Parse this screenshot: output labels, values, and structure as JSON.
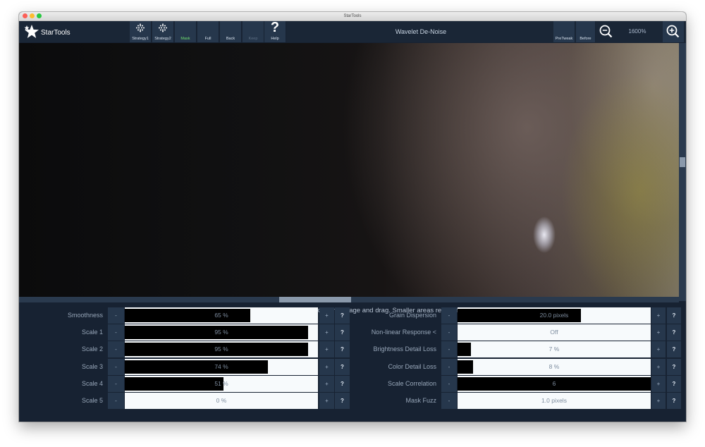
{
  "window": {
    "title": "StarTools"
  },
  "app": {
    "logo_text": "StarTools"
  },
  "toolbar": {
    "buttons": [
      {
        "label": "Strategy1"
      },
      {
        "label": "Strategy2"
      },
      {
        "label": "Mask"
      },
      {
        "label": "Full"
      },
      {
        "label": "Back"
      },
      {
        "label": "Keep"
      },
      {
        "label": "Help",
        "icon": "?"
      }
    ],
    "tool_title": "Wavelet De-Noise",
    "pretweak_label": "PreTweak",
    "before_label": "Before",
    "zoom": "1600%"
  },
  "hint": "To define a preview area, click on the image and drag. Smaller areas render faster.",
  "params_left": [
    {
      "label": "Smoothness",
      "value": "65 %",
      "fraction": 0.65
    },
    {
      "label": "Scale 1",
      "value": "95 %",
      "fraction": 0.95
    },
    {
      "label": "Scale 2",
      "value": "95 %",
      "fraction": 0.95
    },
    {
      "label": "Scale 3",
      "value": "74 %",
      "fraction": 0.74
    },
    {
      "label": "Scale 4",
      "value": "51 %",
      "fraction": 0.51
    },
    {
      "label": "Scale 5",
      "value": "0 %",
      "fraction": 0
    }
  ],
  "params_right": [
    {
      "label": "Grain Dispersion",
      "value": "20.0 pixels",
      "fraction": 0.64
    },
    {
      "label": "Non-linear Response <",
      "value": "Off",
      "fraction": 0
    },
    {
      "label": "Brightness Detail Loss",
      "value": "7 %",
      "fraction": 0.07
    },
    {
      "label": "Color Detail Loss",
      "value": "8 %",
      "fraction": 0.08
    },
    {
      "label": "Scale Correlation",
      "value": "6",
      "fraction": 1
    },
    {
      "label": "Mask Fuzz",
      "value": "1.0 pixels",
      "fraction": 0
    }
  ],
  "controls": {
    "minus": "-",
    "plus": "+",
    "help": "?"
  },
  "icons": {
    "logo": "star-icon",
    "strategy": "dot-grid-icon",
    "help": "question-mark-icon",
    "zoom_out": "magnifier-minus-icon",
    "zoom_in": "magnifier-plus-icon"
  }
}
